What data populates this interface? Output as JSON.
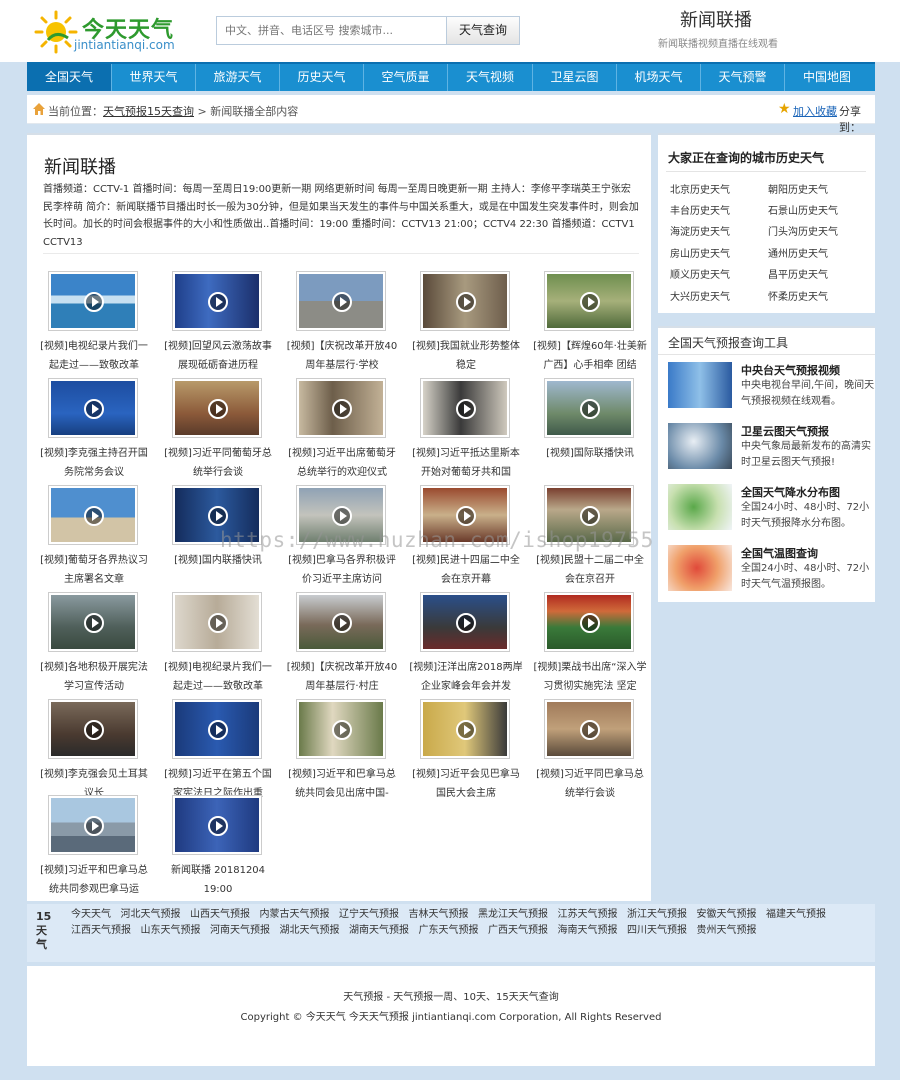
{
  "header": {
    "logo_cn": "今天天气",
    "logo_en": "jintiantianqi.com",
    "search_placeholder": "中文、拼音、电话区号 搜索城市...",
    "search_button": "天气查询",
    "title": "新闻联播",
    "subtitle": "新闻联播视频直播在线观看"
  },
  "nav": [
    "全国天气",
    "世界天气",
    "旅游天气",
    "历史天气",
    "空气质量",
    "天气视频",
    "卫星云图",
    "机场天气",
    "天气预警",
    "中国地图"
  ],
  "breadcrumb": {
    "prefix": "当前位置：",
    "link": "天气预报15天查询",
    "rest": " > 新闻联播全部内容",
    "favorite": "加入收藏",
    "share": "分享到："
  },
  "main": {
    "title": "新闻联播",
    "intro": "首播频道：CCTV-1 首播时间：每周一至周日19:00更新一期 网络更新时间 每周一至周日晚更新一期 主持人：李修平李瑞英王宁张宏民李梓萌 简介：新闻联播节目播出时长一般为30分钟，但是如果当天发生的事件与中国关系重大，或是在中国发生突发事件时，则会加长时间。加长的时间会根据事件的大小和性质做出..首播时间：19:00 重播时间：CCTV13 21:00；CCTV4 22:30 首播频道：CCTV1 CCTV13",
    "videos": [
      "[视频]电视纪录片我们一起走过——致敬改革",
      "[视频]回望风云激荡故事 展现砥砺奋进历程",
      "[视频]【庆祝改革开放40周年基层行·学校",
      "[视频]我国就业形势整体稳定",
      "[视频]【辉煌60年·壮美新广西】心手相牵 团结",
      "[视频]李克强主持召开国务院常务会议",
      "[视频]习近平同葡萄牙总统举行会谈",
      "[视频]习近平出席葡萄牙总统举行的欢迎仪式",
      "[视频]习近平抵达里斯本开始对葡萄牙共和国",
      "[视频]国际联播快讯",
      "[视频]葡萄牙各界热议习主席署名文章",
      "[视频]国内联播快讯",
      "[视频]巴拿马各界积极评价习近平主席访问",
      "[视频]民进十四届二中全会在京开幕",
      "[视频]民盟十二届二中全会在京召开",
      "[视频]各地积极开展宪法学习宣传活动",
      "[视频]电视纪录片我们一起走过——致敬改革",
      "[视频]【庆祝改革开放40周年基层行·村庄",
      "[视频]汪洋出席2018两岸企业家峰会年会并发",
      "[视频]栗战书出席“深入学习贯彻实施宪法 坚定",
      "[视频]李克强会见土耳其议长",
      "[视频]习近平在第五个国家宪法日之际作出重",
      "[视频]习近平和巴拿马总统共同会见出席中国-",
      "[视频]习近平会见巴拿马国民大会主席",
      "[视频]习近平同巴拿马总统举行会谈",
      "[视频]习近平和巴拿马总统共同参观巴拿马运",
      "新闻联播 20181204 19:00"
    ]
  },
  "sidebar": {
    "history_title": "大家正在查询的城市历史天气",
    "history_links": [
      "北京历史天气",
      "朝阳历史天气",
      "丰台历史天气",
      "石景山历史天气",
      "海淀历史天气",
      "门头沟历史天气",
      "房山历史天气",
      "通州历史天气",
      "顺义历史天气",
      "昌平历史天气",
      "大兴历史天气",
      "怀柔历史天气"
    ],
    "tools_title": "全国天气预报查询工具",
    "tools": [
      {
        "title": "中央台天气预报视频",
        "desc": "中央电视台早间,午间，晚间天气预报视频在线观看。"
      },
      {
        "title": "卫星云图天气预报",
        "desc": "中央气象局最新发布的高清实时卫星云图天气预报!"
      },
      {
        "title": "全国天气降水分布图",
        "desc": "全国24小时、48小时、72小时天气预报降水分布图。"
      },
      {
        "title": "全国气温图查询",
        "desc": "全国24小时、48小时、72小时天气气温预报图。"
      }
    ]
  },
  "provinces": {
    "label": "15天气",
    "links": [
      "今天天气",
      "河北天气预报",
      "山西天气预报",
      "内蒙古天气预报",
      "辽宁天气预报",
      "吉林天气预报",
      "黑龙江天气预报",
      "江苏天气预报",
      "浙江天气预报",
      "安徽天气预报",
      "福建天气预报",
      "江西天气预报",
      "山东天气预报",
      "河南天气预报",
      "湖北天气预报",
      "湖南天气预报",
      "广东天气预报",
      "广西天气预报",
      "海南天气预报",
      "四川天气预报",
      "贵州天气预报"
    ]
  },
  "footer": {
    "line1": "天气预报 - 天气预报一周、10天、15天天气查询",
    "line2": "Copyright © 今天天气 今天天气预报 jintiantianqi.com Corporation, All Rights Reserved"
  },
  "watermark": "https://www.huzhan.com/ishop19755",
  "colors": {
    "nav_blue": "#1a8fd0",
    "nav_active": "#0b6fb0",
    "page_bg": "#cfe0f0",
    "logo_green": "#2e9a2e"
  }
}
